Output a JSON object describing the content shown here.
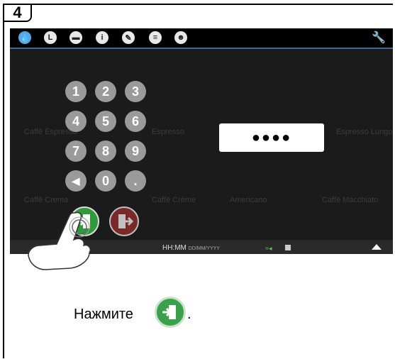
{
  "step": {
    "number": "4"
  },
  "toolbar": {
    "icons": [
      "water-drop-icon",
      "clock-icon",
      "flag-icon",
      "info-icon",
      "pencil-icon",
      "list-icon",
      "user-icon"
    ],
    "settings_icon": "wrench-icon"
  },
  "keypad": {
    "keys": [
      "1",
      "2",
      "3",
      "4",
      "5",
      "6",
      "7",
      "8",
      "9",
      "◀",
      "0",
      "."
    ]
  },
  "pin": {
    "value": "●●●●"
  },
  "background_labels": [
    "Caffè Espresso",
    "Espresso",
    "Espresso Lungo",
    "Caffè Crema",
    "Caffè Crème",
    "Americano",
    "Caffè Macchiato"
  ],
  "status": {
    "time": "HH:MM",
    "date": "DD/MM/YYYY"
  },
  "instruction": {
    "text": "Нажмите",
    "period": "."
  },
  "colors": {
    "accent": "#3a6b9c",
    "confirm": "#2e9a3d",
    "exit": "#8c2b2b"
  }
}
